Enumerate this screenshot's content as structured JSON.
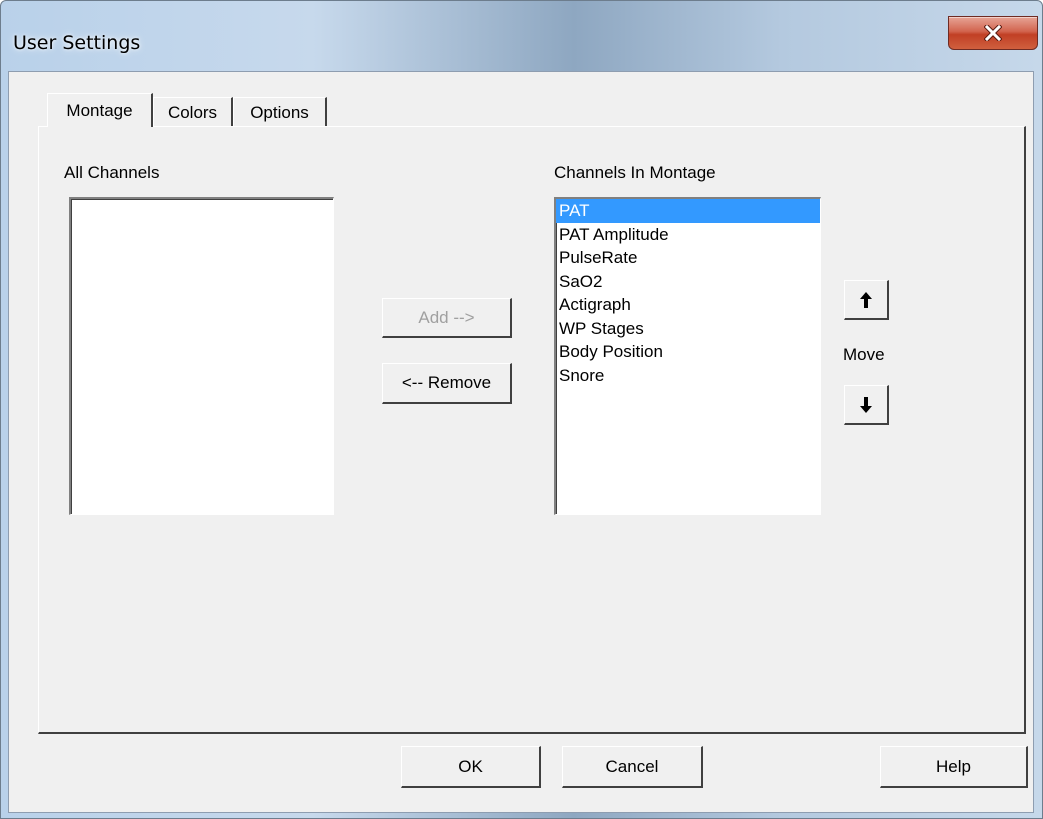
{
  "window": {
    "title": "User Settings"
  },
  "tabs": [
    {
      "label": "Montage",
      "active": true
    },
    {
      "label": "Colors",
      "active": false
    },
    {
      "label": "Options",
      "active": false
    }
  ],
  "montage": {
    "all_channels_label": "All Channels",
    "all_channels": [],
    "montage_label": "Channels In Montage",
    "montage_channels": [
      "PAT",
      "PAT Amplitude",
      "PulseRate",
      "SaO2",
      "Actigraph",
      "WP Stages",
      "Body Position",
      "Snore"
    ],
    "selected_channel": "PAT",
    "add_label": "Add -->",
    "add_enabled": false,
    "remove_label": "<-- Remove",
    "move_label": "Move"
  },
  "footer": {
    "ok_label": "OK",
    "cancel_label": "Cancel",
    "help_label": "Help"
  },
  "colors": {
    "selection": "#3399ff",
    "close_button": "#c13f25"
  },
  "icons": {
    "close": "close-icon",
    "move_up": "arrow-up-icon",
    "move_down": "arrow-down-icon"
  }
}
